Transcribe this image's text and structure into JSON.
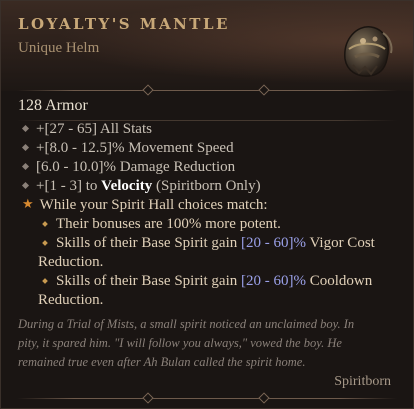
{
  "item": {
    "name": "LOYALTY'S MANTLE",
    "type": "Unique Helm",
    "icon": "helm-icon",
    "armor": "128 Armor"
  },
  "affixes": [
    "+[27 - 65] All Stats",
    "+[8.0 - 12.5]% Movement Speed",
    "[6.0 - 10.0]% Damage Reduction"
  ],
  "velocity_affix": {
    "prefix": "+[1 - 3] to ",
    "skill": "Velocity",
    "suffix": " (Spiritborn Only)"
  },
  "unique_power": {
    "intro": "While your Spirit Hall choices match:",
    "line1": "Their bonuses are 100% more potent.",
    "line2_prefix": "Skills of their Base Spirit gain ",
    "line2_range": "[20 - 60]%",
    "line2_suffix": " Vigor Cost",
    "line2_cont": "Reduction.",
    "line3_prefix": "Skills of their Base Spirit gain ",
    "line3_range": "[20 - 60]%",
    "line3_suffix": " Cooldown",
    "line3_cont": "Reduction."
  },
  "flavor": {
    "line1": "During a Trial of Mists, a small spirit noticed an unclaimed boy. In",
    "line2": "pity, it spared him. \"I will follow you always,\" vowed the boy. He",
    "line3": "remained true even after Ah Bulan called the spirit home."
  },
  "class_requirement": "Spiritborn",
  "colors": {
    "title": "#c8a878",
    "range_blue": "#9aa0e8",
    "unique_star": "#d88a30"
  }
}
